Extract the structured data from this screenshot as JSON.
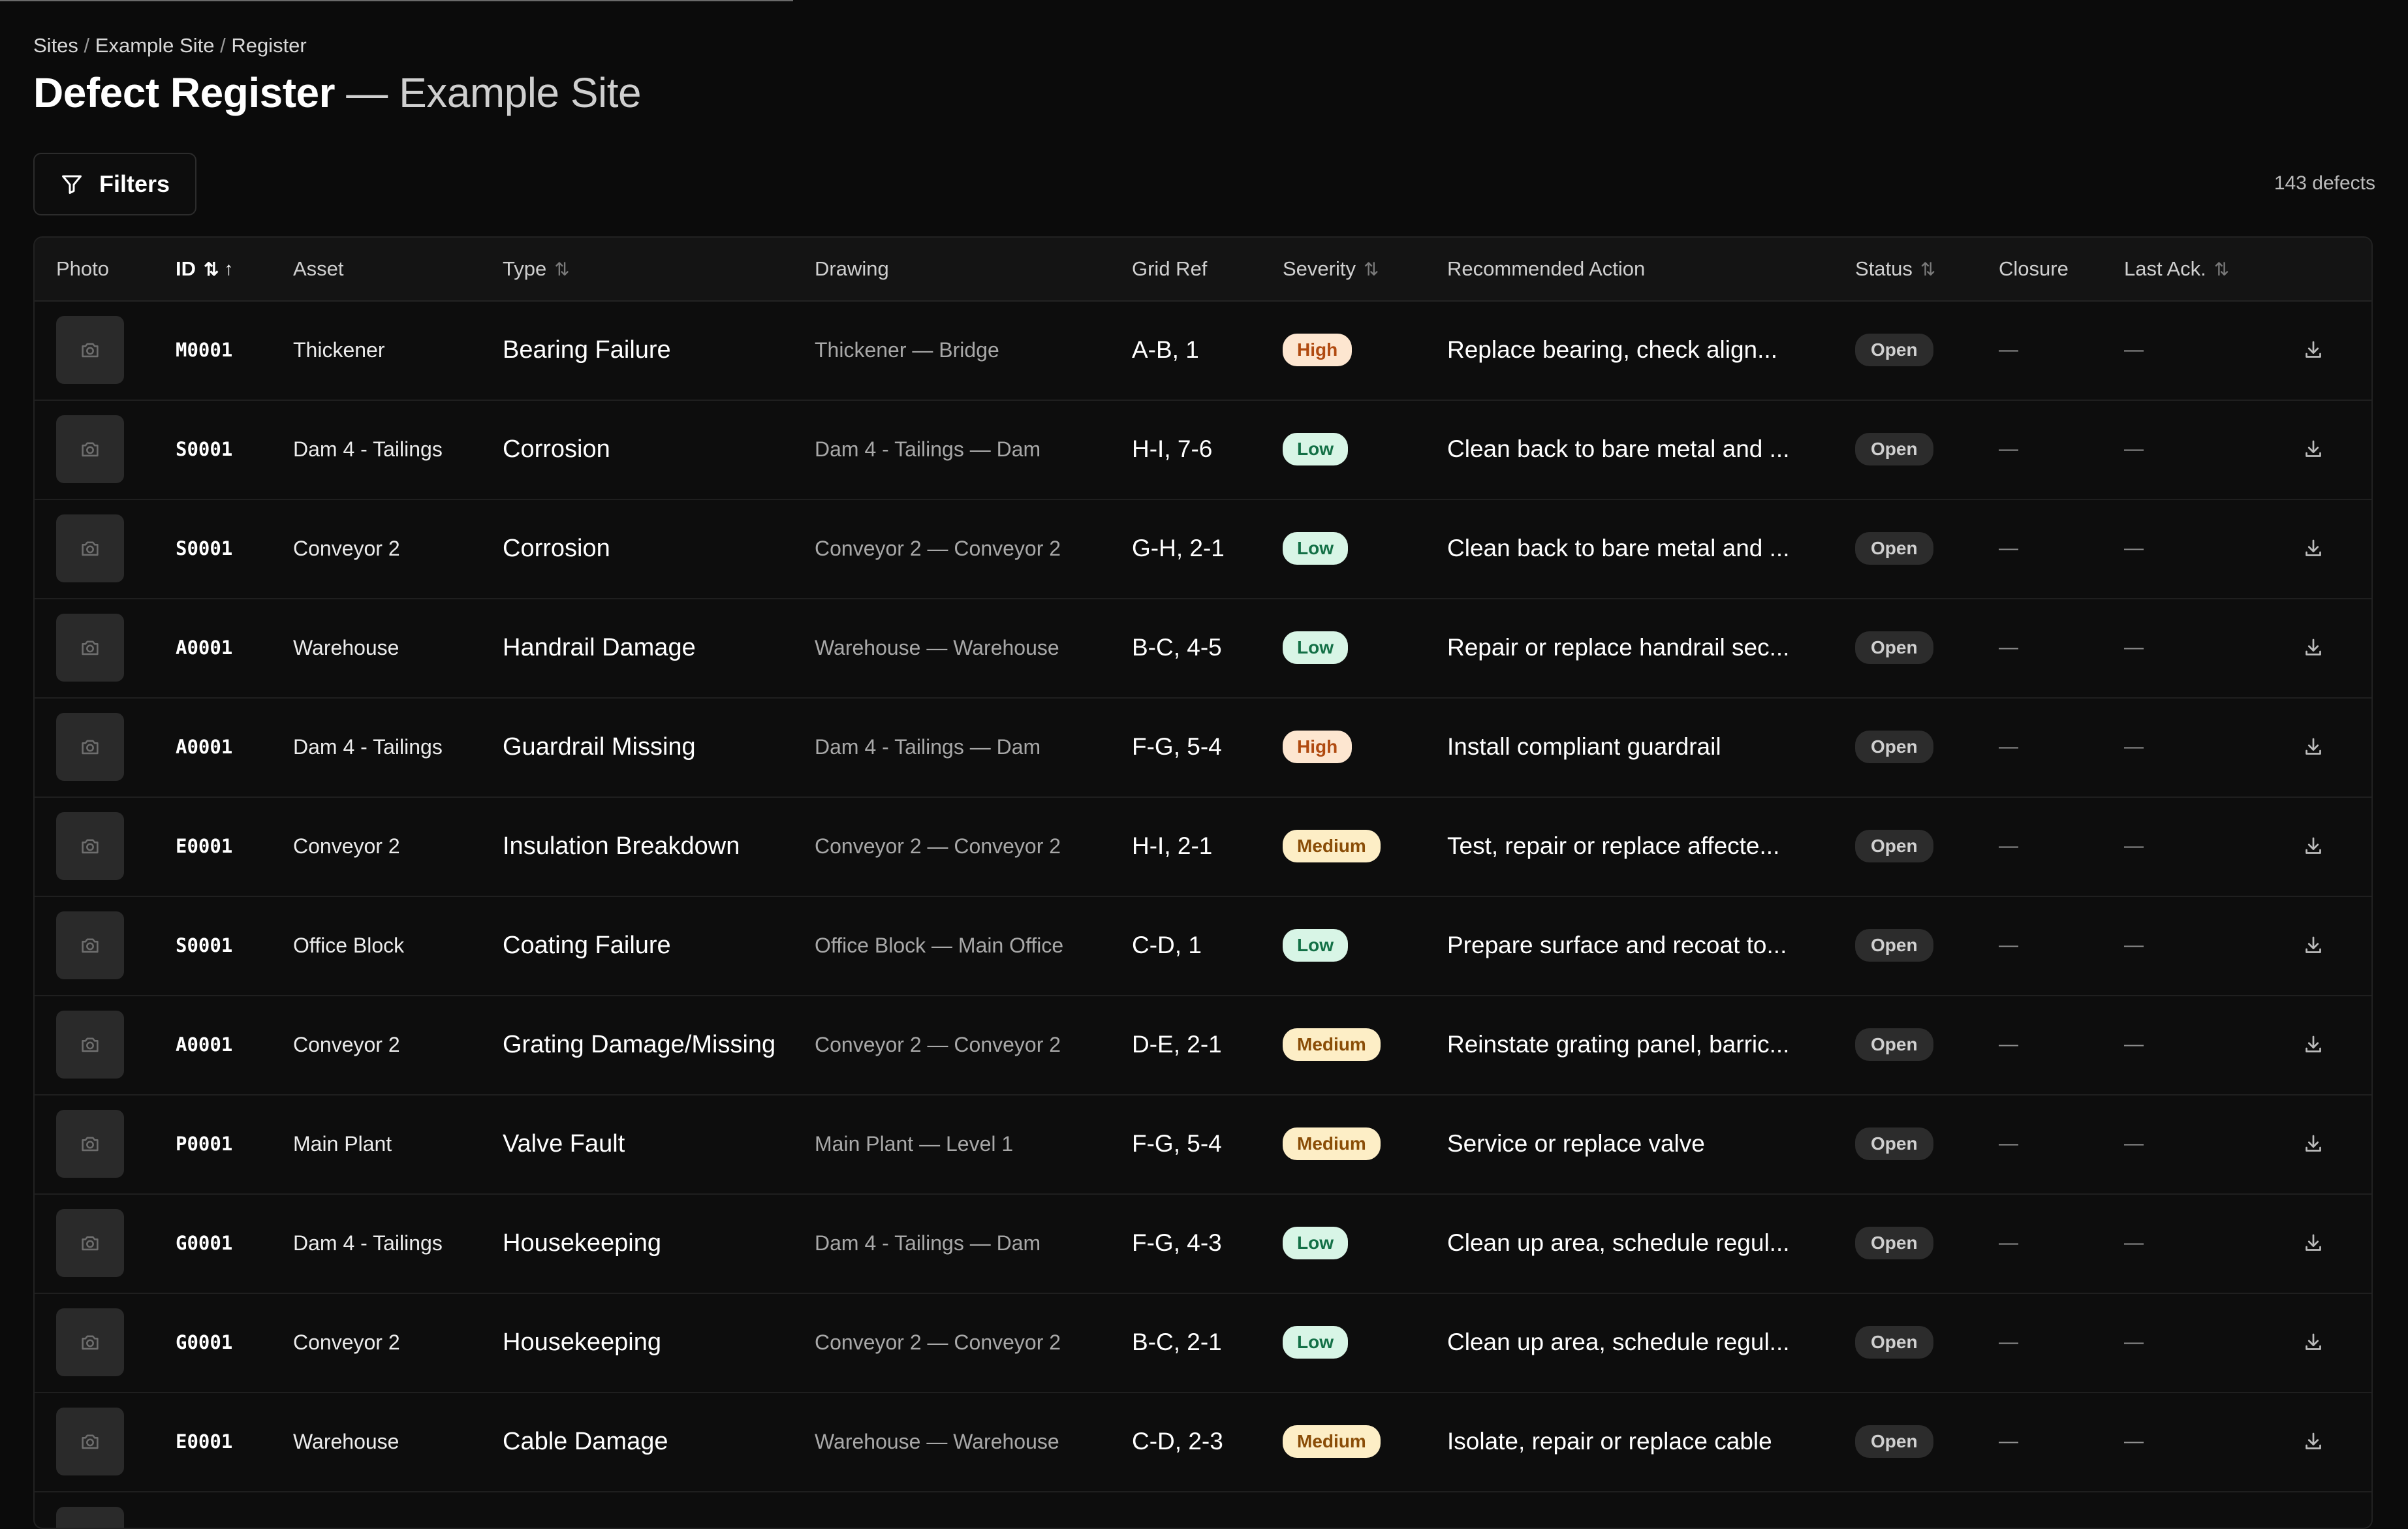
{
  "breadcrumb": {
    "site": "Sites",
    "example_site": "Example Site",
    "register": "Register",
    "separator": "/"
  },
  "title": {
    "main": "Defect Register",
    "sub": "— Example Site"
  },
  "filters": {
    "label": "Filters",
    "icon": "filter-icon"
  },
  "count_label": "143 defects",
  "columns": {
    "photo": "Photo",
    "id": "ID",
    "asset": "Asset",
    "type": "Type",
    "drawing": "Drawing",
    "grid_ref": "Grid Ref",
    "severity": "Severity",
    "action": "Recommended Action",
    "status": "Status",
    "closure": "Closure",
    "last_ack": "Last Ack."
  },
  "sort_glyphs": {
    "both": "⇅",
    "asc": "↑"
  },
  "icons": {
    "photo": "camera-icon",
    "download": "download-icon"
  },
  "colors": {
    "high_bg": "#fde6d0",
    "low_bg": "#d8f5e6",
    "medium_bg": "#fdeec6",
    "status_bg": "#2c2c2c"
  },
  "rows": [
    {
      "id": "M0001",
      "asset": "Thickener",
      "type": "Bearing Failure",
      "drawing": "Thickener — Bridge",
      "grid": "A-B, 1",
      "severity": "High",
      "action": "Replace bearing, check align...",
      "status": "Open",
      "closure": "—",
      "last_ack": "—"
    },
    {
      "id": "S0001",
      "asset": "Dam 4 - Tailings",
      "type": "Corrosion",
      "drawing": "Dam 4 - Tailings — Dam",
      "grid": "H-I, 7-6",
      "severity": "Low",
      "action": "Clean back to bare metal and ...",
      "status": "Open",
      "closure": "—",
      "last_ack": "—"
    },
    {
      "id": "S0001",
      "asset": "Conveyor 2",
      "type": "Corrosion",
      "drawing": "Conveyor 2 — Conveyor 2",
      "grid": "G-H, 2-1",
      "severity": "Low",
      "action": "Clean back to bare metal and ...",
      "status": "Open",
      "closure": "—",
      "last_ack": "—"
    },
    {
      "id": "A0001",
      "asset": "Warehouse",
      "type": "Handrail Damage",
      "drawing": "Warehouse — Warehouse",
      "grid": "B-C, 4-5",
      "severity": "Low",
      "action": "Repair or replace handrail sec...",
      "status": "Open",
      "closure": "—",
      "last_ack": "—"
    },
    {
      "id": "A0001",
      "asset": "Dam 4 - Tailings",
      "type": "Guardrail Missing",
      "drawing": "Dam 4 - Tailings — Dam",
      "grid": "F-G, 5-4",
      "severity": "High",
      "action": "Install compliant guardrail",
      "status": "Open",
      "closure": "—",
      "last_ack": "—"
    },
    {
      "id": "E0001",
      "asset": "Conveyor 2",
      "type": "Insulation Breakdown",
      "drawing": "Conveyor 2 — Conveyor 2",
      "grid": "H-I, 2-1",
      "severity": "Medium",
      "action": "Test, repair or replace affecte...",
      "status": "Open",
      "closure": "—",
      "last_ack": "—"
    },
    {
      "id": "S0001",
      "asset": "Office Block",
      "type": "Coating Failure",
      "drawing": "Office Block — Main Office",
      "grid": "C-D, 1",
      "severity": "Low",
      "action": "Prepare surface and recoat to...",
      "status": "Open",
      "closure": "—",
      "last_ack": "—"
    },
    {
      "id": "A0001",
      "asset": "Conveyor 2",
      "type": "Grating Damage/Missing",
      "drawing": "Conveyor 2 — Conveyor 2",
      "grid": "D-E, 2-1",
      "severity": "Medium",
      "action": "Reinstate grating panel, barric...",
      "status": "Open",
      "closure": "—",
      "last_ack": "—"
    },
    {
      "id": "P0001",
      "asset": "Main Plant",
      "type": "Valve Fault",
      "drawing": "Main Plant — Level 1",
      "grid": "F-G, 5-4",
      "severity": "Medium",
      "action": "Service or replace valve",
      "status": "Open",
      "closure": "—",
      "last_ack": "—"
    },
    {
      "id": "G0001",
      "asset": "Dam 4 - Tailings",
      "type": "Housekeeping",
      "drawing": "Dam 4 - Tailings — Dam",
      "grid": "F-G, 4-3",
      "severity": "Low",
      "action": "Clean up area, schedule regul...",
      "status": "Open",
      "closure": "—",
      "last_ack": "—"
    },
    {
      "id": "G0001",
      "asset": "Conveyor 2",
      "type": "Housekeeping",
      "drawing": "Conveyor 2 — Conveyor 2",
      "grid": "B-C, 2-1",
      "severity": "Low",
      "action": "Clean up area, schedule regul...",
      "status": "Open",
      "closure": "—",
      "last_ack": "—"
    },
    {
      "id": "E0001",
      "asset": "Warehouse",
      "type": "Cable Damage",
      "drawing": "Warehouse — Warehouse",
      "grid": "C-D, 2-3",
      "severity": "Medium",
      "action": "Isolate, repair or replace cable",
      "status": "Open",
      "closure": "—",
      "last_ack": "—"
    }
  ]
}
